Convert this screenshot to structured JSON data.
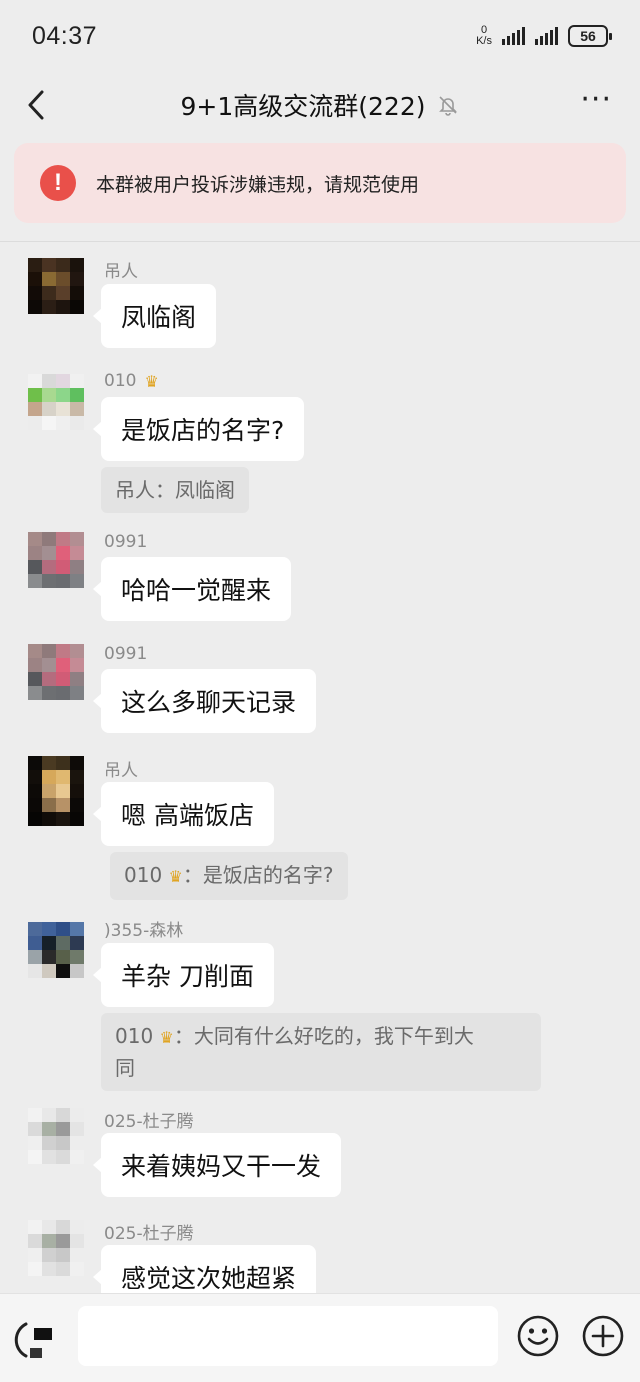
{
  "status_bar": {
    "time": "04:37",
    "net_speed_value": "0",
    "net_speed_unit": "K/s",
    "battery": "56"
  },
  "header": {
    "title": "9+1高级交流群(222)",
    "back_icon": "chevron-left-icon",
    "mute_icon": "bell-off-icon",
    "more_label": "···"
  },
  "notice": {
    "icon": "!",
    "text": "本群被用户投诉涉嫌违规，请规范使用"
  },
  "messages": [
    {
      "sender": "吊人",
      "text": "凤临阁",
      "crown": false
    },
    {
      "sender": "010",
      "text": "是饭店的名字?",
      "crown": true,
      "quote": "吊人：凤临阁"
    },
    {
      "sender": "0991",
      "text": "哈哈一觉醒来",
      "crown": false
    },
    {
      "sender": "0991",
      "text": "这么多聊天记录",
      "crown": false
    },
    {
      "sender": "吊人",
      "text": "嗯 高端饭店",
      "crown": false,
      "quote_prefix": "010",
      "quote_text": "：是饭店的名字?"
    },
    {
      "sender": ")355-森林",
      "text": "羊杂 刀削面",
      "crown": false,
      "quote_prefix": "010",
      "quote_text": "：大同有什么好吃的，我下午到大",
      "quote_text2": "同"
    },
    {
      "sender": "025-杜子腾",
      "text": "来着姨妈又干一发",
      "crown": false
    },
    {
      "sender": "025-杜子腾",
      "text": "感觉这次她超紧",
      "crown": false
    }
  ],
  "input_bar": {
    "voice_icon": "voice-icon",
    "emoji_icon": "emoji-icon",
    "plus_icon": "plus-icon"
  },
  "colors": {
    "background": "#ededed",
    "notice_bg": "#f7e2e2",
    "notice_icon": "#e9504a",
    "bubble": "#ffffff",
    "quote_bg": "#e3e3e3",
    "crown": "#e0a422"
  }
}
